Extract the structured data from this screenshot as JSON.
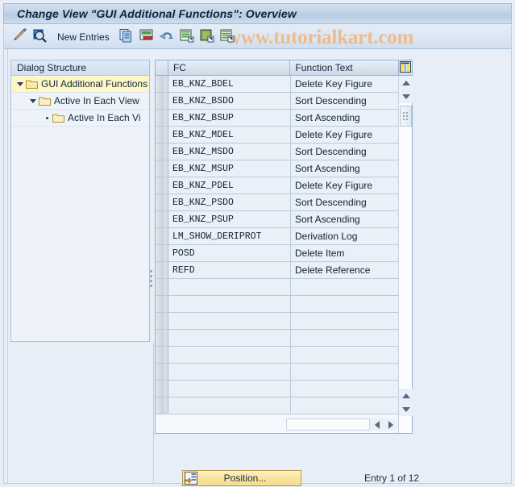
{
  "window": {
    "title": "Change View \"GUI Additional Functions\": Overview"
  },
  "toolbar": {
    "items": [
      {
        "name": "display-change-icon",
        "label": ""
      },
      {
        "name": "check-magnifier-icon",
        "label": ""
      },
      {
        "name": "new-entries-button",
        "label": "New Entries"
      },
      {
        "name": "copy-as-icon",
        "label": ""
      },
      {
        "name": "delete-icon",
        "label": ""
      },
      {
        "name": "undo-icon",
        "label": ""
      },
      {
        "name": "select-all-icon",
        "label": ""
      },
      {
        "name": "deselect-all-icon",
        "label": ""
      },
      {
        "name": "select-block-icon",
        "label": ""
      }
    ],
    "new_entries_label": "New Entries"
  },
  "watermark": {
    "text": "www.tutorialkart.com",
    "color": "#eebb8c"
  },
  "tree": {
    "header": "Dialog Structure",
    "items": [
      {
        "label": "GUI Additional Functions",
        "indent": 0,
        "expander": "down",
        "highlight": true
      },
      {
        "label": "Active In Each View",
        "indent": 1,
        "expander": "down",
        "highlight": false
      },
      {
        "label": "Active In Each Vi",
        "indent": 2,
        "expander": "leaf",
        "highlight": false
      }
    ]
  },
  "table": {
    "columns": [
      "FC",
      "Function Text"
    ],
    "config_icon": "table-settings-icon",
    "rows": [
      {
        "fc": "EB_KNZ_BDEL",
        "text": "Delete Key Figure"
      },
      {
        "fc": "EB_KNZ_BSDO",
        "text": "Sort Descending"
      },
      {
        "fc": "EB_KNZ_BSUP",
        "text": "Sort Ascending"
      },
      {
        "fc": "EB_KNZ_MDEL",
        "text": "Delete Key Figure"
      },
      {
        "fc": "EB_KNZ_MSDO",
        "text": "Sort Descending"
      },
      {
        "fc": "EB_KNZ_MSUP",
        "text": "Sort Ascending"
      },
      {
        "fc": "EB_KNZ_PDEL",
        "text": "Delete Key Figure"
      },
      {
        "fc": "EB_KNZ_PSDO",
        "text": "Sort Descending"
      },
      {
        "fc": "EB_KNZ_PSUP",
        "text": "Sort Ascending"
      },
      {
        "fc": "LM_SHOW_DERIPROT",
        "text": "Derivation Log"
      },
      {
        "fc": "POSD",
        "text": "Delete Item"
      },
      {
        "fc": "REFD",
        "text": "Delete Reference"
      },
      {
        "fc": "",
        "text": ""
      },
      {
        "fc": "",
        "text": ""
      },
      {
        "fc": "",
        "text": ""
      },
      {
        "fc": "",
        "text": ""
      },
      {
        "fc": "",
        "text": ""
      },
      {
        "fc": "",
        "text": ""
      },
      {
        "fc": "",
        "text": ""
      },
      {
        "fc": "",
        "text": ""
      }
    ]
  },
  "footer": {
    "position_label": "Position...",
    "entry_count": "Entry 1 of 12"
  }
}
